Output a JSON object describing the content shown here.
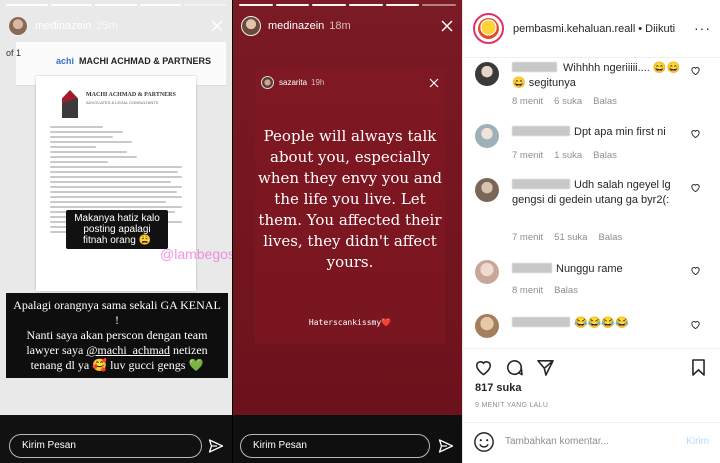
{
  "story_left": {
    "username": "medinazein",
    "time": "25m",
    "document": {
      "brand_prefix": "achi",
      "brand_name": "MACHI ACHMAD & PARTNERS",
      "page_indicator": "of 1",
      "letter_title": "MACHI ACHMAD & PARTNERS",
      "letter_subtitle": "ADVOCATES & LEGAL CONSULTANTS"
    },
    "caption_small": "Makanya hatiz kalo posting apalagi fitnah orang 😩",
    "caption_large_1": "Apalagi orangnya sama sekali GA KENAL !",
    "caption_large_2": "Nanti saya akan perscon dengan team lawyer saya ",
    "caption_mention": "@machi_achmad",
    "caption_large_3": " netizen tenang dl ya 🥰 luv gucci gengs ",
    "caption_heart": "💚",
    "watermark": "@lambegosip",
    "reply_placeholder": "Kirim Pesan"
  },
  "story_right": {
    "username": "medinazein",
    "time": "18m",
    "inner_username": "sazarita",
    "inner_time": "19h",
    "quote": "People will always talk about you, especially when they envy you and the life you live. Let them. You affected their lives, they didn't affect yours.",
    "hashtag": "Haterscankissmy❤️",
    "reply_placeholder": "Kirim Pesan"
  },
  "post": {
    "username": "pembasmi.kehaluan.reall",
    "follow_label": "Diikuti",
    "more_label": "···",
    "comments": [
      {
        "text": "Wihhhh ngeriiiii.... 😄😄😄 segitunya",
        "time": "8 menit",
        "likes": "6 suka",
        "reply": "Balas"
      },
      {
        "text": "Dpt apa min first ni",
        "time": "7 menit",
        "likes": "1 suka",
        "reply": "Balas"
      },
      {
        "text": "Udh salah ngeyel lg gengsi di gedein utang ga byr2(:",
        "time": "7 menit",
        "likes": "51 suka",
        "reply": "Balas"
      },
      {
        "text": "Nunggu rame",
        "time": "8 menit",
        "likes": "",
        "reply": "Balas"
      },
      {
        "text": "😂😂😂😂",
        "time": "",
        "likes": "",
        "reply": ""
      }
    ],
    "likes_count": "817 suka",
    "posted_ago": "9 MENIT YANG LALU",
    "add_comment_placeholder": "Tambahkan komentar...",
    "post_button": "Kirim"
  }
}
